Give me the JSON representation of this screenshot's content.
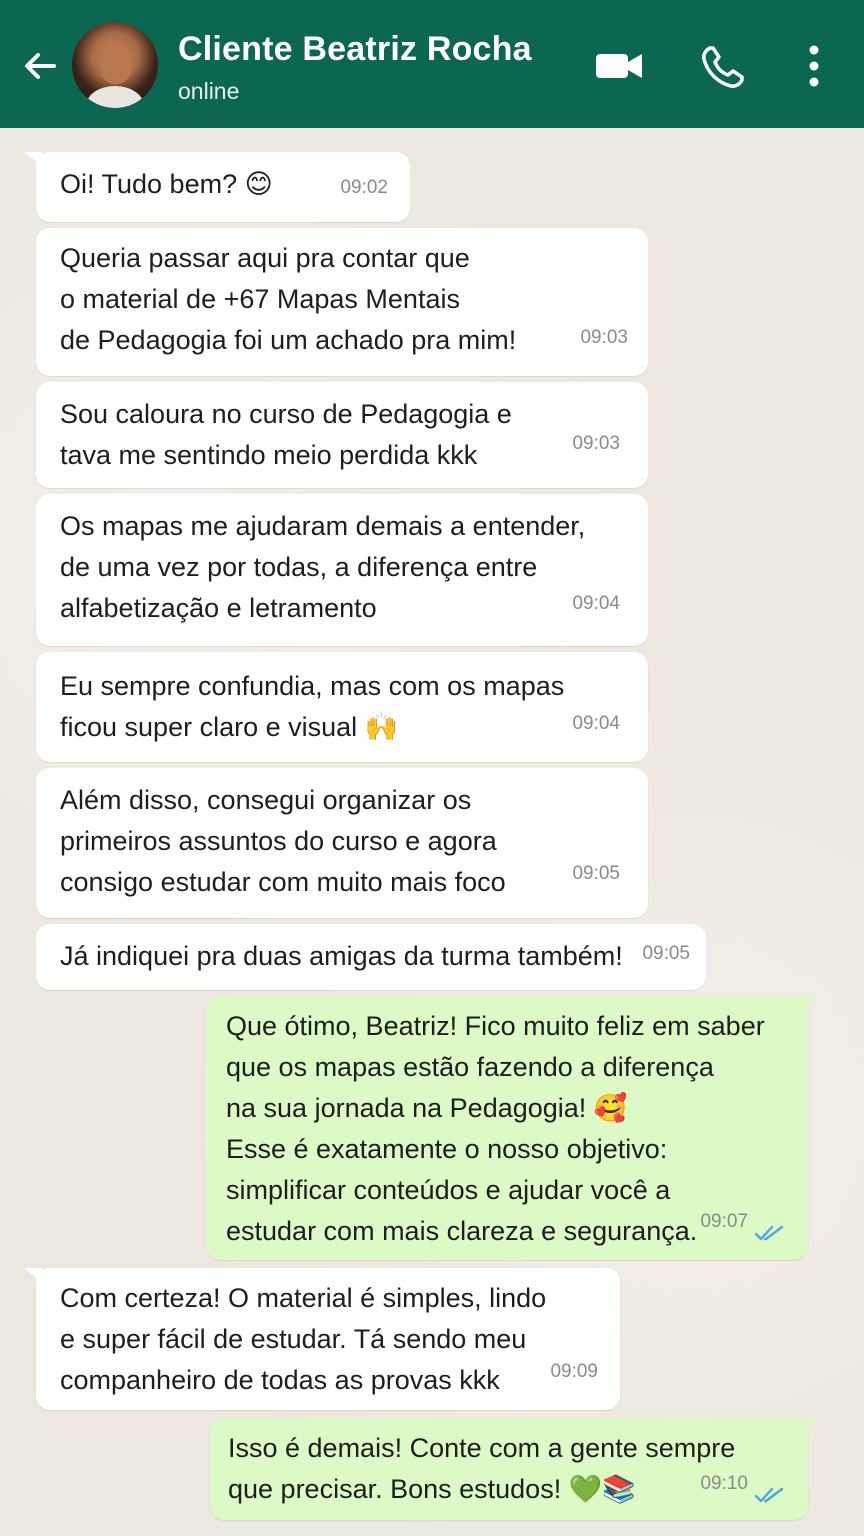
{
  "header": {
    "contact_name": "Cliente Beatriz Rocha",
    "status": "online",
    "accent_color": "#0b6652",
    "icons": [
      "back-arrow-icon",
      "video-call-icon",
      "phone-icon",
      "more-options-icon"
    ]
  },
  "messages": [
    {
      "direction": "in",
      "text": "Oi! Tudo bem? 😊",
      "time": "09:02"
    },
    {
      "direction": "in",
      "text": "Queria passar aqui pra contar que\no material de +67 Mapas Mentais\nde Pedagogia foi um achado pra mim!",
      "time": "09:03"
    },
    {
      "direction": "in",
      "text": "Sou caloura no curso de Pedagogia e\ntava me sentindo meio perdida kkk",
      "time": "09:03"
    },
    {
      "direction": "in",
      "text": "Os mapas me ajudaram demais a entender,\nde uma vez por todas, a diferença entre\nalfabetização e letramento",
      "time": "09:04"
    },
    {
      "direction": "in",
      "text": "Eu sempre confundia, mas com os mapas\nficou super claro e visual 🙌",
      "time": "09:04"
    },
    {
      "direction": "in",
      "text": "Além disso, consegui organizar os\nprimeiros assuntos do curso e agora\nconsigo estudar com muito mais foco",
      "time": "09:05"
    },
    {
      "direction": "in",
      "text": "Já indiquei pra duas amigas da turma também!",
      "time": "09:05"
    },
    {
      "direction": "out",
      "text": "Que ótimo, Beatriz! Fico muito feliz em saber\nque os mapas estão fazendo a diferença\nna sua jornada na Pedagogia! 🥰\nEsse é exatamente o nosso objetivo:\nsimplificar conteúdos e ajudar você a\nestudar com mais clareza e segurança.",
      "time": "09:07",
      "read": true
    },
    {
      "direction": "in",
      "text": "Com certeza! O material é simples, lindo\ne super fácil de estudar. Tá sendo meu\ncompanheiro de todas as provas kkk",
      "time": "09:09"
    },
    {
      "direction": "out",
      "text": "Isso é demais! Conte com a gente sempre\nque precisar. Bons estudos! 💚📚",
      "time": "09:10",
      "read": true
    }
  ],
  "colors": {
    "incoming_bubble": "#ffffff",
    "outgoing_bubble": "#dcf9c6",
    "read_ticks": "#4fa6e0"
  }
}
